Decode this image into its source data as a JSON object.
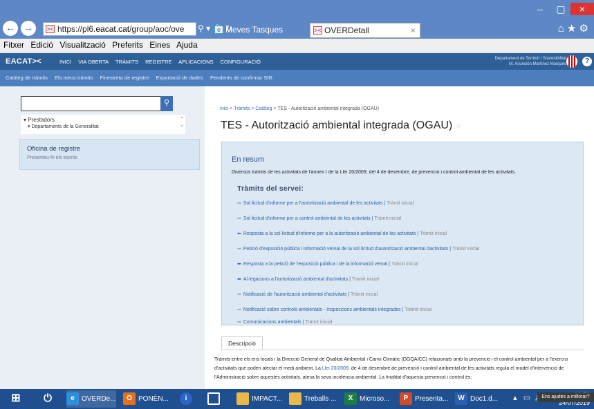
{
  "browser": {
    "url_prefix": "https://pl6.",
    "url_host": "eacat.cat",
    "url_rest": "/group/aoc/ove",
    "tabs": [
      {
        "label": "Meves Tasques"
      },
      {
        "label": "OVERDetall",
        "close": "×"
      }
    ],
    "window_controls": {
      "minimize": "–",
      "maximize": "▢",
      "close": "×"
    },
    "menu": [
      "Fitxer",
      "Edició",
      "Visualització",
      "Preferits",
      "Eines",
      "Ajuda"
    ]
  },
  "app": {
    "logo": "EACAT><",
    "topnav": [
      "INICI",
      "VIA OBERTA",
      "TRÀMITS",
      "REGISTRE",
      "APLICACIONS",
      "CONFIGURACIÓ"
    ],
    "dept_line1": "Departament de Territori i Sostenibilitat",
    "dept_line2": "M. Asunción Martínez Marqués",
    "subnav": [
      "Catàleg de tràmits",
      "Els meus tràmits",
      "Finestreta de registre",
      "Exportació de dades",
      "Pendents de confirmar SIR"
    ]
  },
  "sidebar": {
    "search_placeholder": "",
    "tree_root": "▾ Prestadors",
    "tree_child": "▾ Departaments de la Generalitat",
    "office_title": "Oficina de registre",
    "office_sub": "Presenteu-hi els escrits"
  },
  "main": {
    "breadcrumb": [
      "Inici",
      "Tràmits",
      "Catàleg"
    ],
    "breadcrumb_current": "TES - Autorització ambiental integrada (OGAU)",
    "title": "TES - Autorització ambiental integrada (OGAU)",
    "resum_heading": "En resum",
    "resum_text": "Diversos tràmits de les activitats de l'annex I de la Llei 20/2009, del 4 de desembre, de prevenció i control ambiental de les activitats.",
    "serveis_heading": "Tràmits del servei:",
    "tramits": [
      {
        "label": "Sol·licitud d'informe per a l'autorització ambiental de les activitats",
        "kind": "Tràmit inicial",
        "dir": "out"
      },
      {
        "label": "Sol·licitud d'informe per a control ambiental de les activitats",
        "kind": "Tràmit inicial",
        "dir": "out"
      },
      {
        "label": "Resposta a la sol·licitud d'informe per a la autorització ambiental de les activitats",
        "kind": "Tràmit inicial",
        "dir": "in"
      },
      {
        "label": "Petició d'exposició pública i informació veïnal de la sol·licitud d'autorització ambiental dactivitats",
        "kind": "Tràmit inicial",
        "dir": "out"
      },
      {
        "label": "Resposta a la petició de l'exposició pública i de la informació veïnal",
        "kind": "Tràmit inicial",
        "dir": "in"
      },
      {
        "label": "Al·legacions a l'autorització ambiental d'activitats",
        "kind": "Tràmit inicial",
        "dir": "in"
      },
      {
        "label": "Notificació de l'autorització ambiental d'activitats",
        "kind": "Tràmit inicial",
        "dir": "out"
      },
      {
        "label": "Notificació sobre controls ambientals - Inspeccions ambientals integrades",
        "kind": "Tràmit inicial",
        "dir": "out"
      },
      {
        "label": "Comunicacions ambientals",
        "kind": "Tràmit inicial",
        "dir": "out"
      }
    ],
    "desc_tab": "Descripció",
    "desc_line1": "Tràmits entre els ens locals i la Direcció General de Qualitat Ambiental i Canvi Climàtic (DGQAICC) relacionats amb la prevenció i el control ambiental per a l'exercici",
    "desc_line2_a": "d'activitats que poden afectar el medi ambient. La ",
    "desc_line2_link": "Llei 20/2009",
    "desc_line2_b": ", de 4 de desembre,de prevenció i control ambiental de les activitats regula el model d'intervenció de",
    "desc_line3": "l'Administració sobre aquestes activitats, atesa la seva incidència ambiental. La finalitat d'aquesta prevenció i control és:"
  },
  "tooltip": "Ens ajudes a millorar?",
  "taskbar": {
    "items": [
      {
        "label": "OVERDe...",
        "icon": "e",
        "color": "#2d8fe0"
      },
      {
        "label": "PONÈN...",
        "icon": "O",
        "color": "#e8701a"
      },
      {
        "label": "",
        "icon": "i",
        "color": "#2a66c9"
      },
      {
        "label": "",
        "icon": "",
        "color": "#3b5f8a"
      },
      {
        "label": "IMPACT...",
        "icon": "▮",
        "color": "#e8b84a"
      },
      {
        "label": "Treballs ...",
        "icon": "▮",
        "color": "#e8b84a"
      },
      {
        "label": "Microso...",
        "icon": "X",
        "color": "#1e7d45"
      },
      {
        "label": "Presenta...",
        "icon": "P",
        "color": "#d04b2a"
      },
      {
        "label": "Doc1.d...",
        "icon": "W",
        "color": "#2b5fb3"
      }
    ],
    "time": "10:51",
    "date": "24/07/2019"
  }
}
